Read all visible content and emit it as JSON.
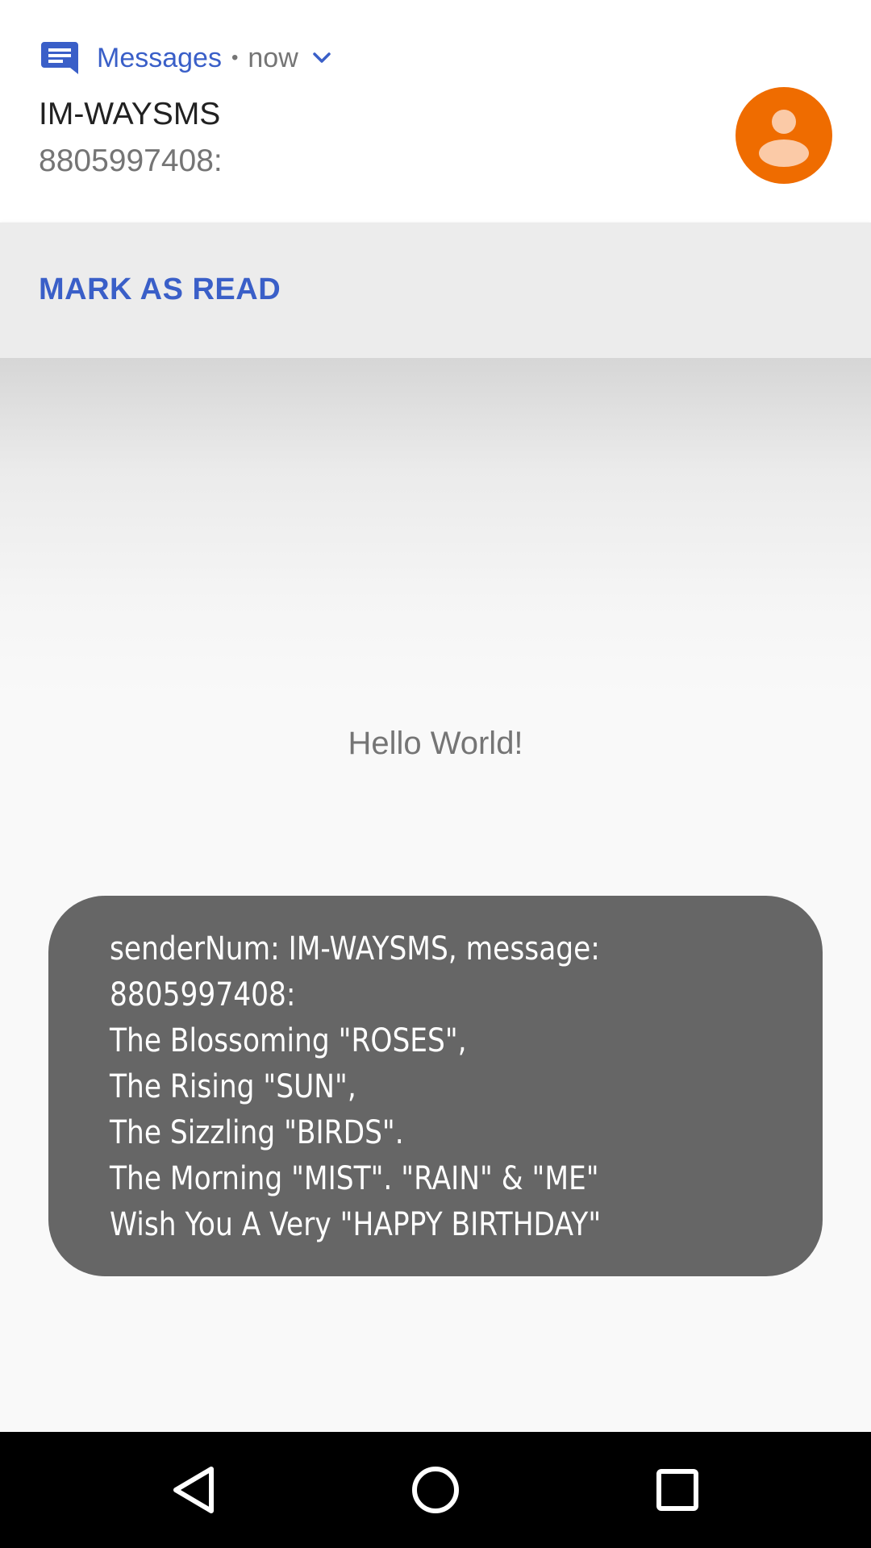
{
  "notification": {
    "app_name": "Messages",
    "separator": "•",
    "time": "now",
    "title": "IM-WAYSMS",
    "text": "8805997408:",
    "action_label": "MARK AS READ",
    "accent_color": "#3a5fc8",
    "avatar_color": "#ef6c00",
    "icons": {
      "app": "messages-icon",
      "expand": "chevron-down-icon",
      "avatar": "person-icon"
    }
  },
  "app": {
    "greeting": "Hello World!"
  },
  "toast": {
    "text": "senderNum: IM-WAYSMS, message:\n8805997408:\nThe Blossoming \"ROSES\",\nThe Rising \"SUN\",\nThe Sizzling \"BIRDS\".\nThe Morning \"MIST\". \"RAIN\" & \"ME\"\nWish You A Very \"HAPPY BIRTHDAY\""
  },
  "navbar": {
    "icons": [
      "back-icon",
      "home-icon",
      "recents-icon"
    ]
  }
}
